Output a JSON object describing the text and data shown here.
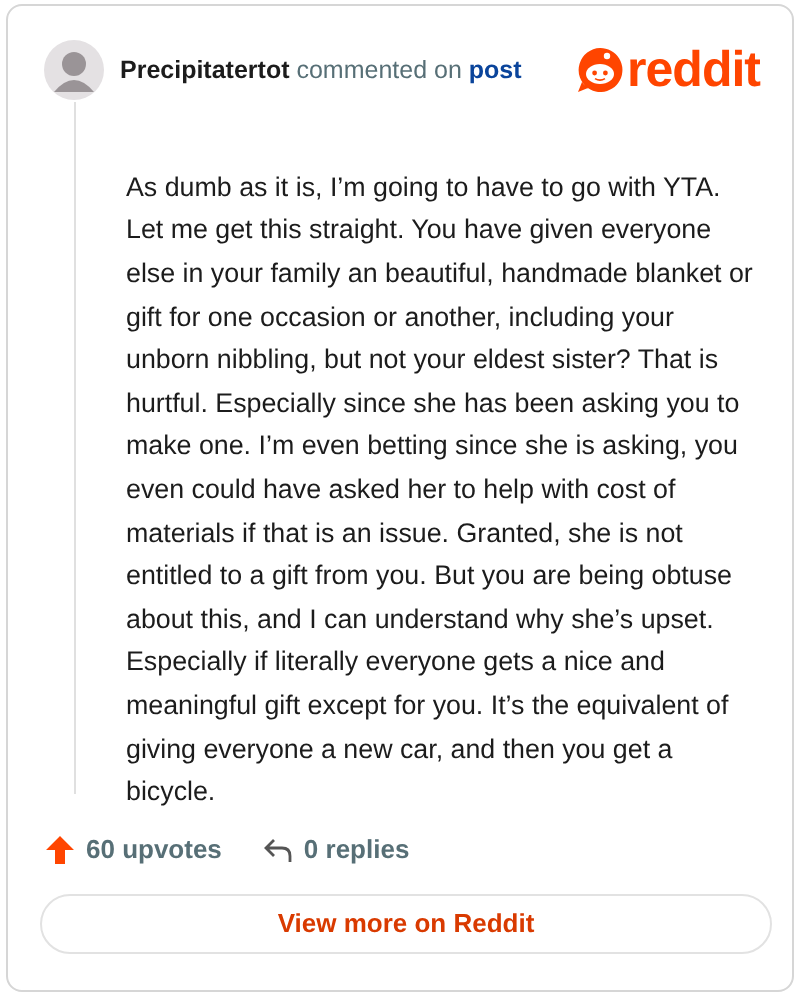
{
  "comment": {
    "author": "Precipitatertot",
    "action": "commented on",
    "target": "post",
    "logo_text": "reddit",
    "body": "As dumb as it is, I’m going to have to go with YTA. Let me get this straight. You have given everyone else in your family an beautiful, handmade blanket or gift for one occasion or another, including your unborn nibbling, but not your eldest sister? That is hurtful. Especially since she has been asking you to make one. I’m even betting since she is asking, you even could have asked her to help with cost of materials if that is an issue. Granted, she is not entitled to a gift from you. But you are being obtuse about this, and I can understand why she’s upset. Especially if literally everyone gets a nice and meaningful gift except for you. It’s the equivalent of giving everyone a new car, and then you get a bicycle.",
    "upvotes": "60 upvotes",
    "replies": "0 replies"
  },
  "button": "View more on Reddit"
}
